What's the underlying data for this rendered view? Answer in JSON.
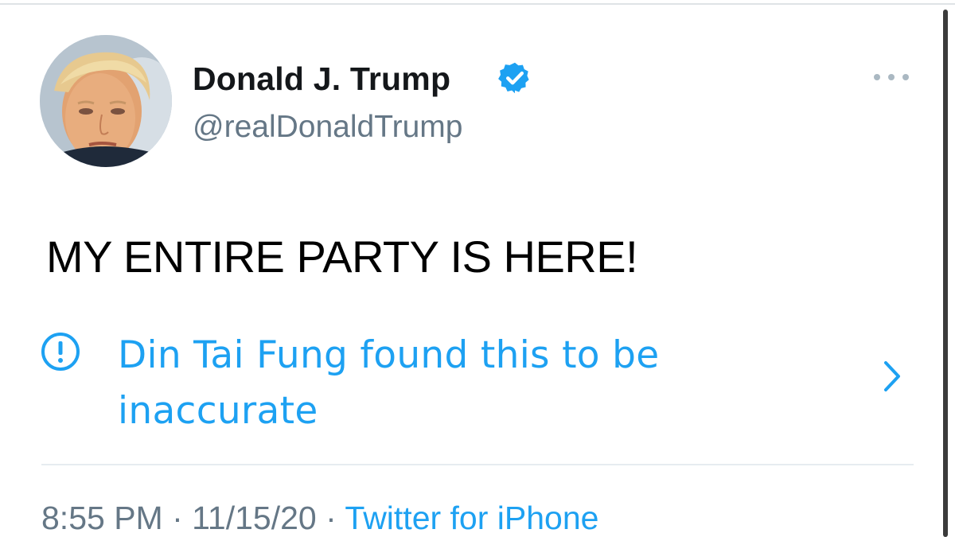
{
  "tweet": {
    "author": {
      "display_name": "Donald J. Trump",
      "handle": "@realDonaldTrump",
      "verified_icon": "verified-badge-icon",
      "avatar": "profile-photo"
    },
    "more_icon": "more-options-icon",
    "text": "MY ENTIRE PARTY IS HERE!",
    "notice": {
      "icon": "exclamation-circle-icon",
      "text": "Din Tai Fung found this to be inaccurate",
      "chevron_icon": "chevron-right-icon"
    },
    "meta": {
      "time": "8:55 PM",
      "separator": " · ",
      "date": "11/15/20",
      "source": "Twitter for iPhone"
    }
  },
  "colors": {
    "accent": "#1da1f2",
    "secondary_text": "#657786",
    "primary_text": "#14171a"
  }
}
